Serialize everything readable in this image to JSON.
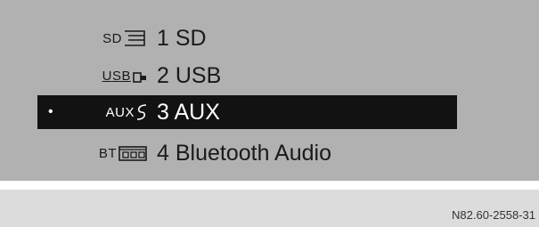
{
  "sources": [
    {
      "icon_text": "SD",
      "icon": "sd-card-icon",
      "label": "1 SD",
      "selected": false
    },
    {
      "icon_text": "USB",
      "icon": "usb-icon",
      "label": "2 USB",
      "selected": false
    },
    {
      "icon_text": "AUX",
      "icon": "aux-icon",
      "label": "3 AUX",
      "selected": true
    },
    {
      "icon_text": "BT",
      "icon": "bluetooth-audio-icon",
      "label": "4 Bluetooth Audio",
      "selected": false
    }
  ],
  "selection_marker": "•",
  "reference_code": "N82.60-2558-31",
  "colors": {
    "screen_bg": "#b1b1b1",
    "selected_bg": "#121212",
    "selected_text": "#ffffff",
    "text": "#1a1a1a"
  }
}
